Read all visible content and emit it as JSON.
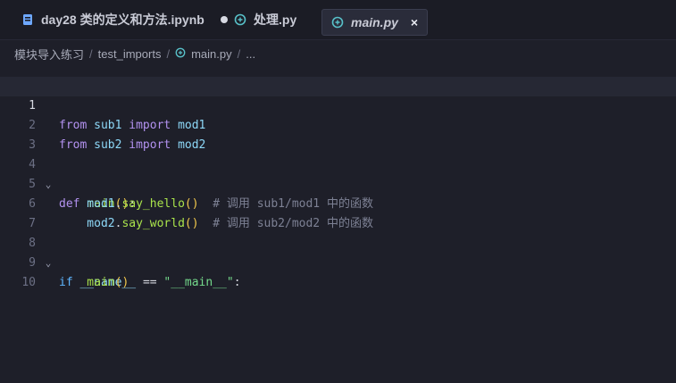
{
  "tabs": [
    {
      "label": "day28 类的定义和方法.ipynb",
      "icon": "notebook-icon",
      "modified": true
    },
    {
      "label": "处理.py",
      "icon": "python-icon"
    },
    {
      "label": "main.py",
      "icon": "python-icon",
      "active": true,
      "close": "×"
    }
  ],
  "breadcrumb": {
    "part1": "模块导入练习",
    "part2": "test_imports",
    "part3": "main.py",
    "part4": "...",
    "separator": "/"
  },
  "editor": {
    "lines": [
      {
        "num": "1",
        "t1": "from",
        "t2": " ",
        "t3": "sub1",
        "t4": " ",
        "t5": "import",
        "t6": " ",
        "t7": "mod1"
      },
      {
        "num": "2",
        "t1": "from",
        "t2": " ",
        "t3": "sub2",
        "t4": " ",
        "t5": "import",
        "t6": " ",
        "t7": "mod2"
      },
      {
        "num": "3"
      },
      {
        "num": "4",
        "fold": "⌄",
        "t1": "def",
        "t2": " ",
        "t3": "main",
        "t4": "()",
        "t5": ":"
      },
      {
        "num": "5",
        "t1": "    mod1",
        "t2": ".",
        "t3": "say_hello",
        "t4": "()",
        "t5": "  # 调用 sub1/mod1 中的函数"
      },
      {
        "num": "6",
        "t1": "    mod2",
        "t2": ".",
        "t3": "say_world",
        "t4": "()",
        "t5": "  # 调用 sub2/mod2 中的函数"
      },
      {
        "num": "7"
      },
      {
        "num": "8",
        "fold": "⌄",
        "t1": "if",
        "t2": " __name__ ",
        "t3": "==",
        "t4": " ",
        "t5": "\"__main__\"",
        "t6": ":"
      },
      {
        "num": "9",
        "t1": "    main",
        "t2": "()"
      },
      {
        "num": "10"
      }
    ]
  }
}
